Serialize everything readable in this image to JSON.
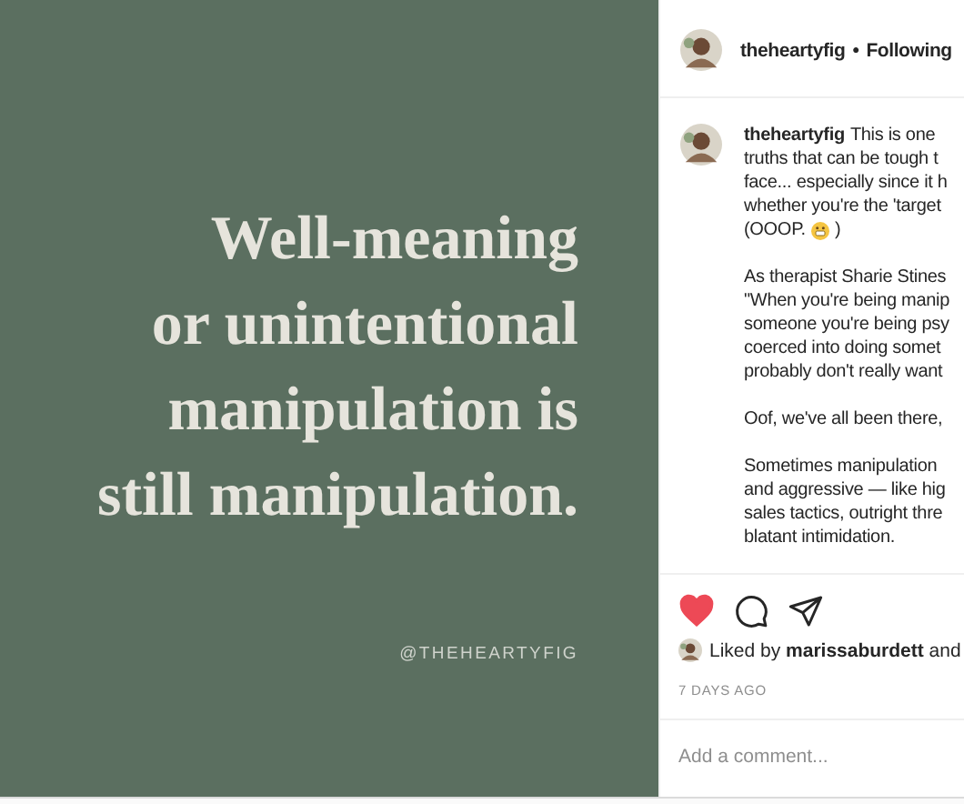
{
  "post_image": {
    "quote_lines": [
      "Well-meaning",
      "or unintentional",
      "manipulation is",
      "still manipulation."
    ],
    "handle": "@THEHEARTYFIG"
  },
  "header": {
    "username": "theheartyfig",
    "separator": "•",
    "follow_label": "Following"
  },
  "caption": {
    "username": "theheartyfig",
    "paragraphs": [
      {
        "lines": [
          {
            "text": "This is one"
          },
          {
            "text": "truths that can be tough t"
          },
          {
            "text": "face... especially since it h"
          },
          {
            "text": "whether you're the 'target"
          },
          {
            "text": "(OOOP.",
            "emoji": true,
            "after": ")"
          }
        ]
      },
      {
        "lines": [
          {
            "text": "As therapist Sharie Stines"
          },
          {
            "text": "\"When you're being manip"
          },
          {
            "text": "someone you're being psy"
          },
          {
            "text": "coerced into doing somet"
          },
          {
            "text": "probably don't really want"
          }
        ]
      },
      {
        "lines": [
          {
            "text": "Oof, we've all been there,"
          }
        ]
      },
      {
        "lines": [
          {
            "text": "Sometimes manipulation"
          },
          {
            "text": "and aggressive — like hig"
          },
          {
            "text": "sales tactics, outright thre"
          },
          {
            "text": "blatant intimidation."
          }
        ]
      }
    ]
  },
  "actions": {
    "liked": true
  },
  "likes": {
    "text": "Liked by **marissaburdett** and"
  },
  "timestamp": "7 DAYS AGO",
  "comment_field": {
    "placeholder": "Add a comment..."
  }
}
